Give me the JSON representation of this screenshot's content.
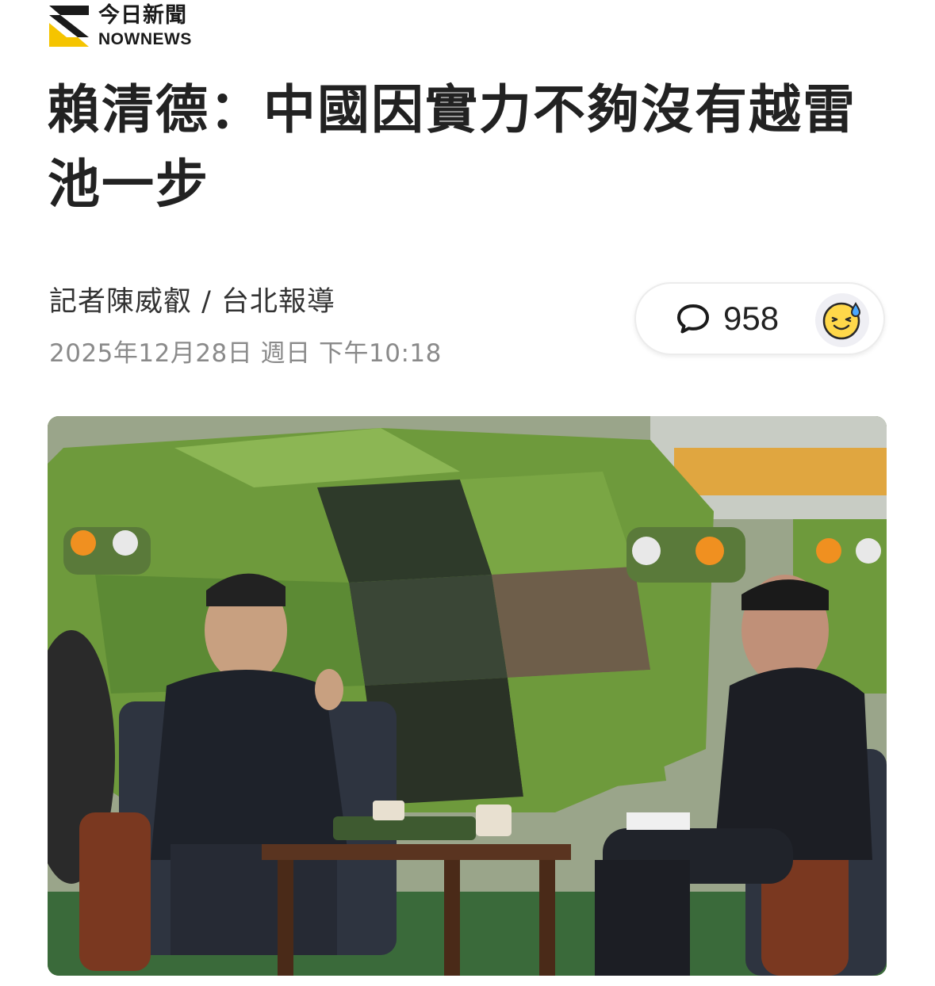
{
  "brand": {
    "name_cn": "今日新聞",
    "name_en": "NOWNEWS",
    "accent": "#f5c400"
  },
  "article": {
    "headline": "賴清德：中國因實力不夠沒有越雷池一步",
    "byline": "記者陳威叡 / 台北報導",
    "date": "2025年12月28日 週日 下午10:18"
  },
  "engagement": {
    "comment_icon": "speech-bubble-icon",
    "comment_count": "958",
    "reaction_icon": "sweat-smile-emoji-icon"
  },
  "photo": {
    "subject": "news-photo-interview-in-front-of-armored-vehicle"
  }
}
